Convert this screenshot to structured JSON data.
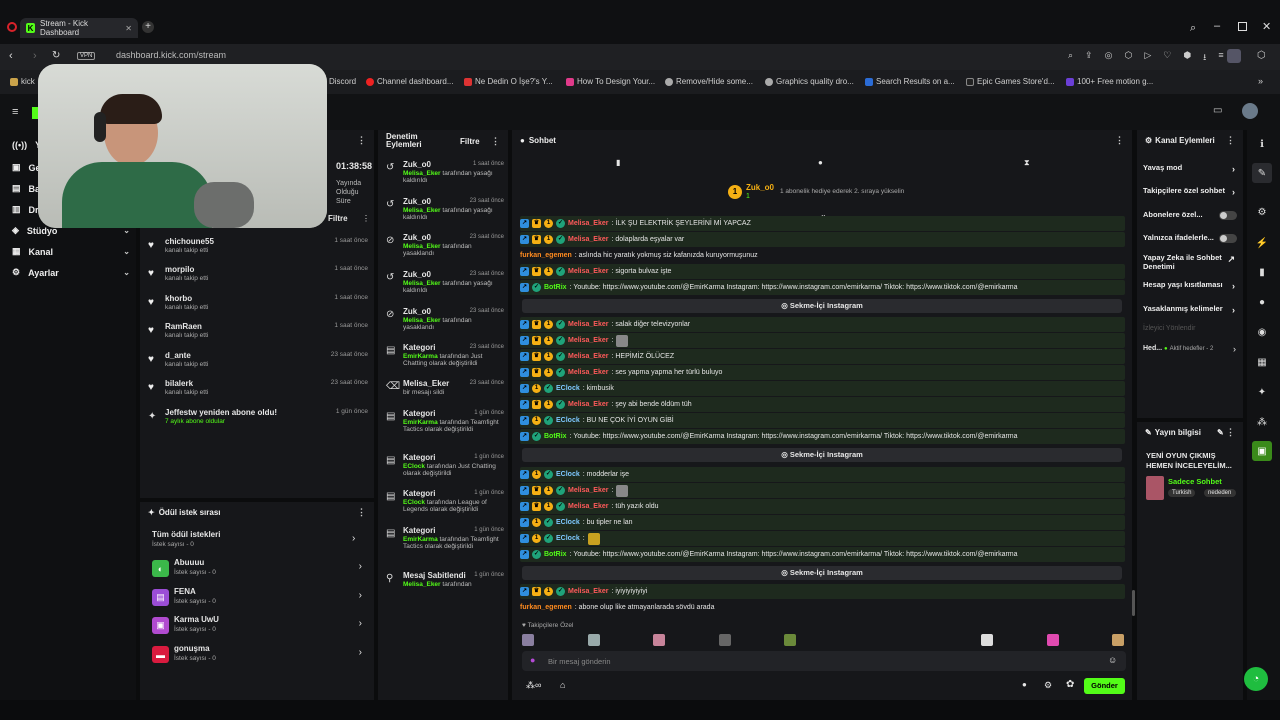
{
  "browser": {
    "tab_title": "Stream - Kick Dashboard",
    "tab_favicon": "K",
    "url": "dashboard.kick.com/stream",
    "vpn_label": "VPN",
    "bookmarks": [
      "kick",
      "Discord",
      "Channel dashboard...",
      "Ne Dedin O İşe?'s Y...",
      "How To Design Your...",
      "Remove/Hide some...",
      "Graphics quality dro...",
      "Search Results on a...",
      "Epic Games Store'd...",
      "100+ Free motion g..."
    ]
  },
  "nav": {
    "items": [
      {
        "label": "Ya",
        "icon": "broadcast-icon"
      },
      {
        "label": "Ge",
        "icon": "home-icon"
      },
      {
        "label": "Ba",
        "icon": "chart-icon"
      },
      {
        "label": "Dr",
        "icon": "folder-icon"
      },
      {
        "label": "Stüdyo",
        "icon": "studio-icon"
      },
      {
        "label": "Kanal",
        "icon": "channel-icon"
      },
      {
        "label": "Ayarlar",
        "icon": "gear-icon"
      }
    ]
  },
  "stream_stats": {
    "duration": "01:38:58",
    "duration_label": "Yayında Olduğu Süre",
    "filter_label": "Filtre"
  },
  "follows": [
    {
      "name": "chichoune55",
      "sub": "kanalı takip etti",
      "time": "1 saat önce"
    },
    {
      "name": "morpilo",
      "sub": "kanalı takip etti",
      "time": "1 saat önce"
    },
    {
      "name": "khorbo",
      "sub": "kanalı takip etti",
      "time": "1 saat önce"
    },
    {
      "name": "RamRaen",
      "sub": "kanalı takip etti",
      "time": "1 saat önce"
    },
    {
      "name": "d_ante",
      "sub": "kanalı takip etti",
      "time": "23 saat önce"
    },
    {
      "name": "bilalerk",
      "sub": "kanalı takip etti",
      "time": "23 saat önce"
    },
    {
      "name": "Jeffestw yeniden abone oldu!",
      "sub": "7 aylık abone oldular",
      "time": "1 gün önce"
    }
  ],
  "rewards": {
    "title": "Ödül istek sırası",
    "all_label": "Tüm ödül istekleri",
    "all_count": "İstek sayısı - 0",
    "items": [
      {
        "name": "Abuuuu",
        "count": "İstek sayısı - 0",
        "color": "#3bb84a"
      },
      {
        "name": "FENA",
        "count": "İstek sayısı - 0",
        "color": "#9b4dd6"
      },
      {
        "name": "Karma UwU",
        "count": "İstek sayısı - 0",
        "color": "#b14bd0"
      },
      {
        "name": "gonuşma",
        "count": "İstek sayısı - 0",
        "color": "#d91b3f"
      }
    ]
  },
  "moderation": {
    "title": "Denetim Eylemleri",
    "filter_label": "Filtre",
    "rows": [
      {
        "title": "Zuk_o0",
        "time": "1 saat önce",
        "actor": "Melisa_Eker",
        "desc": " tarafından yasağı kaldırıldı",
        "icon": "undo-icon"
      },
      {
        "title": "Zuk_o0",
        "time": "23 saat önce",
        "actor": "Melisa_Eker",
        "desc": " tarafından yasağı kaldırıldı",
        "icon": "undo-icon"
      },
      {
        "title": "Zuk_o0",
        "time": "23 saat önce",
        "actor": "Melisa_Eker",
        "desc": " tarafından yasaklandı",
        "icon": "ban-icon"
      },
      {
        "title": "Zuk_o0",
        "time": "23 saat önce",
        "actor": "Melisa_Eker",
        "desc": " tarafından yasağı kaldırıldı",
        "icon": "undo-icon"
      },
      {
        "title": "Zuk_o0",
        "time": "23 saat önce",
        "actor": "Melisa_Eker",
        "desc": " tarafından yasaklandı",
        "icon": "ban-icon"
      },
      {
        "title": "Kategori",
        "time": "23 saat önce",
        "actor": "EmirKarma",
        "desc": " tarafından Just Chatting olarak değiştirildi",
        "icon": "category-icon"
      },
      {
        "title": "Melisa_Eker",
        "time": "23 saat önce",
        "actor": "",
        "desc": "bir mesajı sildi",
        "icon": "trash-icon"
      },
      {
        "title": "Kategori",
        "time": "1 gün önce",
        "actor": "EmirKarma",
        "desc": " tarafından Teamfight Tactics olarak değiştirildi",
        "icon": "category-icon"
      },
      {
        "title": "Kategori",
        "time": "1 gün önce",
        "actor": "EClock",
        "desc": " tarafından Just Chatting olarak değiştirildi",
        "icon": "category-icon"
      },
      {
        "title": "Kategori",
        "time": "1 gün önce",
        "actor": "EClock",
        "desc": " tarafından League of Legends olarak değiştirildi",
        "icon": "category-icon"
      },
      {
        "title": "Kategori",
        "time": "1 gün önce",
        "actor": "EmirKarma",
        "desc": " tarafından Teamfight Tactics olarak değiştirildi",
        "icon": "category-icon"
      },
      {
        "title": "Mesaj Sabitlendi",
        "time": "1 gün önce",
        "actor": "Melisa_Eker",
        "desc": " tarafından",
        "icon": "pin-icon"
      }
    ]
  },
  "chat": {
    "title": "Sohbet",
    "gift_user": "Zuk_o0",
    "gift_count": "1",
    "gift_text": "1 abonelik hediye ederek 2. sıraya yükselin",
    "messages": [
      {
        "user": "Melisa_Eker",
        "color": "r",
        "text": ": İLK ŞU ELEKTRİK ŞEYLERİNİ Mİ YAPCAZ",
        "badges": 4,
        "hl": true
      },
      {
        "user": "Melisa_Eker",
        "color": "r",
        "text": ": dolaplarda eşyalar var",
        "badges": 4,
        "hl": true
      },
      {
        "user": "furkan_egemen",
        "color": "o",
        "text": ": aslında hic yaratık yokmuş siz kafanızda kuruyormuşunuz",
        "badges": 0,
        "hl": false
      },
      {
        "user": "Melisa_Eker",
        "color": "r",
        "text": ": sigorta bulvaz işte",
        "badges": 4,
        "hl": true
      },
      {
        "user": "BotRix",
        "color": "g",
        "text": ": Youtube: https://www.youtube.com/@EmirKarma Instagram: https://www.instagram.com/emirkarma/ Tiktok: https://www.tiktok.com/@emirkarma",
        "badges": 2,
        "hl": true
      },
      {
        "user": "Melisa_Eker",
        "color": "r",
        "text": ": salak diğer televizyonlar",
        "badges": 4,
        "hl": true
      },
      {
        "user": "Melisa_Eker",
        "color": "r",
        "text": ":",
        "badges": 4,
        "hl": true,
        "emote": true
      },
      {
        "user": "Melisa_Eker",
        "color": "r",
        "text": ": HEPİMİZ ÖLÜCEZ",
        "badges": 4,
        "hl": true
      },
      {
        "user": "Melisa_Eker",
        "color": "r",
        "text": ": ses yapma yapma her türlü buluyo",
        "badges": 4,
        "hl": true
      },
      {
        "user": "EClock",
        "color": "c",
        "text": ": kimbusik",
        "badges": 3,
        "hl": true
      },
      {
        "user": "Melisa_Eker",
        "color": "r",
        "text": ": şey abi bende öldüm tüh",
        "badges": 4,
        "hl": true
      },
      {
        "user": "EClock",
        "color": "c",
        "text": ": BU NE ÇOK İYİ OYUN GİBİ",
        "badges": 3,
        "hl": true
      },
      {
        "user": "BotRix",
        "color": "g",
        "text": ": Youtube: https://www.youtube.com/@EmirKarma Instagram: https://www.instagram.com/emirkarma/ Tiktok: https://www.tiktok.com/@emirkarma",
        "badges": 2,
        "hl": true
      },
      {
        "user": "EClock",
        "color": "c",
        "text": ": modderlar işe",
        "badges": 3,
        "hl": true
      },
      {
        "user": "Melisa_Eker",
        "color": "r",
        "text": ":",
        "badges": 4,
        "hl": true,
        "emote": true
      },
      {
        "user": "Melisa_Eker",
        "color": "r",
        "text": ": tüh yazık oldu",
        "badges": 4,
        "hl": true
      },
      {
        "user": "EClock",
        "color": "c",
        "text": ": bu tipler ne lan",
        "badges": 3,
        "hl": true
      },
      {
        "user": "EClock",
        "color": "c",
        "text": ":",
        "badges": 3,
        "hl": true,
        "emote": true
      },
      {
        "user": "BotRix",
        "color": "g",
        "text": ": Youtube: https://www.youtube.com/@EmirKarma Instagram: https://www.instagram.com/emirkarma/ Tiktok: https://www.tiktok.com/@emirkarma",
        "badges": 2,
        "hl": true
      },
      {
        "user": "Melisa_Eker",
        "color": "r",
        "text": ": iyiyiyiyiyiyi",
        "badges": 4,
        "hl": true
      },
      {
        "user": "furkan_egemen",
        "color": "o",
        "text": ": abone olup like atmayanlarada sövdü arada",
        "badges": 0,
        "hl": false
      }
    ],
    "insta_label": "Sekme-İçi Instagram",
    "followers_only_label": "Takipçilere Özel",
    "input_placeholder": "Bir mesaj gönderin",
    "send_label": "Gönder"
  },
  "channel_actions": {
    "title": "Kanal Eylemleri",
    "items": [
      {
        "label": "Yavaş mod",
        "kind": "chev"
      },
      {
        "label": "Takipçilere özel sohbet",
        "kind": "chev"
      },
      {
        "label": "Abonelere özel...",
        "kind": "toggle"
      },
      {
        "label": "Yalnızca ifadelerle...",
        "kind": "toggle"
      },
      {
        "label": "Yapay Zeka ile Sohbet Denetimi",
        "kind": "ext"
      },
      {
        "label": "Hesap yaşı kısıtlaması",
        "kind": "chev"
      },
      {
        "label": "Yasaklanmış kelimeler",
        "kind": "chev"
      }
    ],
    "viewer_redirect": "İzleyici Yönlendir",
    "hed_label": "Hed...",
    "active_goals": "Aktif hedefler - 2"
  },
  "stream_info": {
    "title": "Yayın bilgisi",
    "stream_title": "YENİ OYUN ÇIKMIŞ HEMEN İNCELEYELİM...",
    "mode": "Sadece Sohbet",
    "tags": [
      "Turkish",
      "nededen"
    ]
  },
  "colors": {
    "accent": "#53fc18",
    "bg": "#0b0c0d",
    "panel": "#16171a"
  }
}
